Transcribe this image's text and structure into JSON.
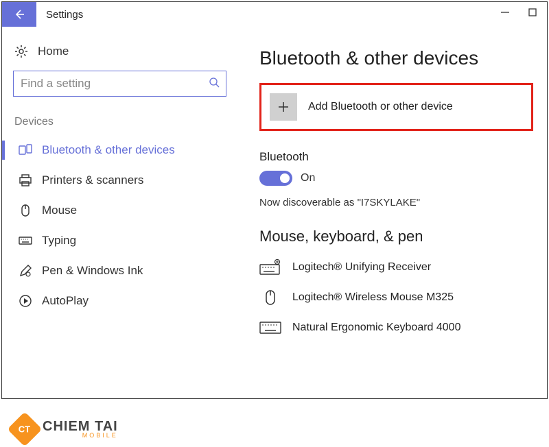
{
  "titlebar": {
    "title": "Settings"
  },
  "sidebar": {
    "home": "Home",
    "search_placeholder": "Find a setting",
    "section_label": "Devices",
    "items": [
      {
        "label": "Bluetooth & other devices"
      },
      {
        "label": "Printers & scanners"
      },
      {
        "label": "Mouse"
      },
      {
        "label": "Typing"
      },
      {
        "label": "Pen & Windows Ink"
      },
      {
        "label": "AutoPlay"
      }
    ]
  },
  "main": {
    "heading": "Bluetooth & other devices",
    "add_device_label": "Add Bluetooth or other device",
    "bluetooth": {
      "label": "Bluetooth",
      "state": "On",
      "discoverable": "Now discoverable as \"I7SKYLAKE\""
    },
    "devices_heading": "Mouse, keyboard, & pen",
    "devices": [
      {
        "label": "Logitech® Unifying Receiver",
        "icon": "keyboard-usb"
      },
      {
        "label": "Logitech® Wireless Mouse M325",
        "icon": "mouse"
      },
      {
        "label": "Natural Ergonomic Keyboard 4000",
        "icon": "keyboard"
      }
    ]
  },
  "logo": {
    "badge": "CT",
    "text_big": "CHIEM TAI",
    "text_small": "MOBILE"
  }
}
